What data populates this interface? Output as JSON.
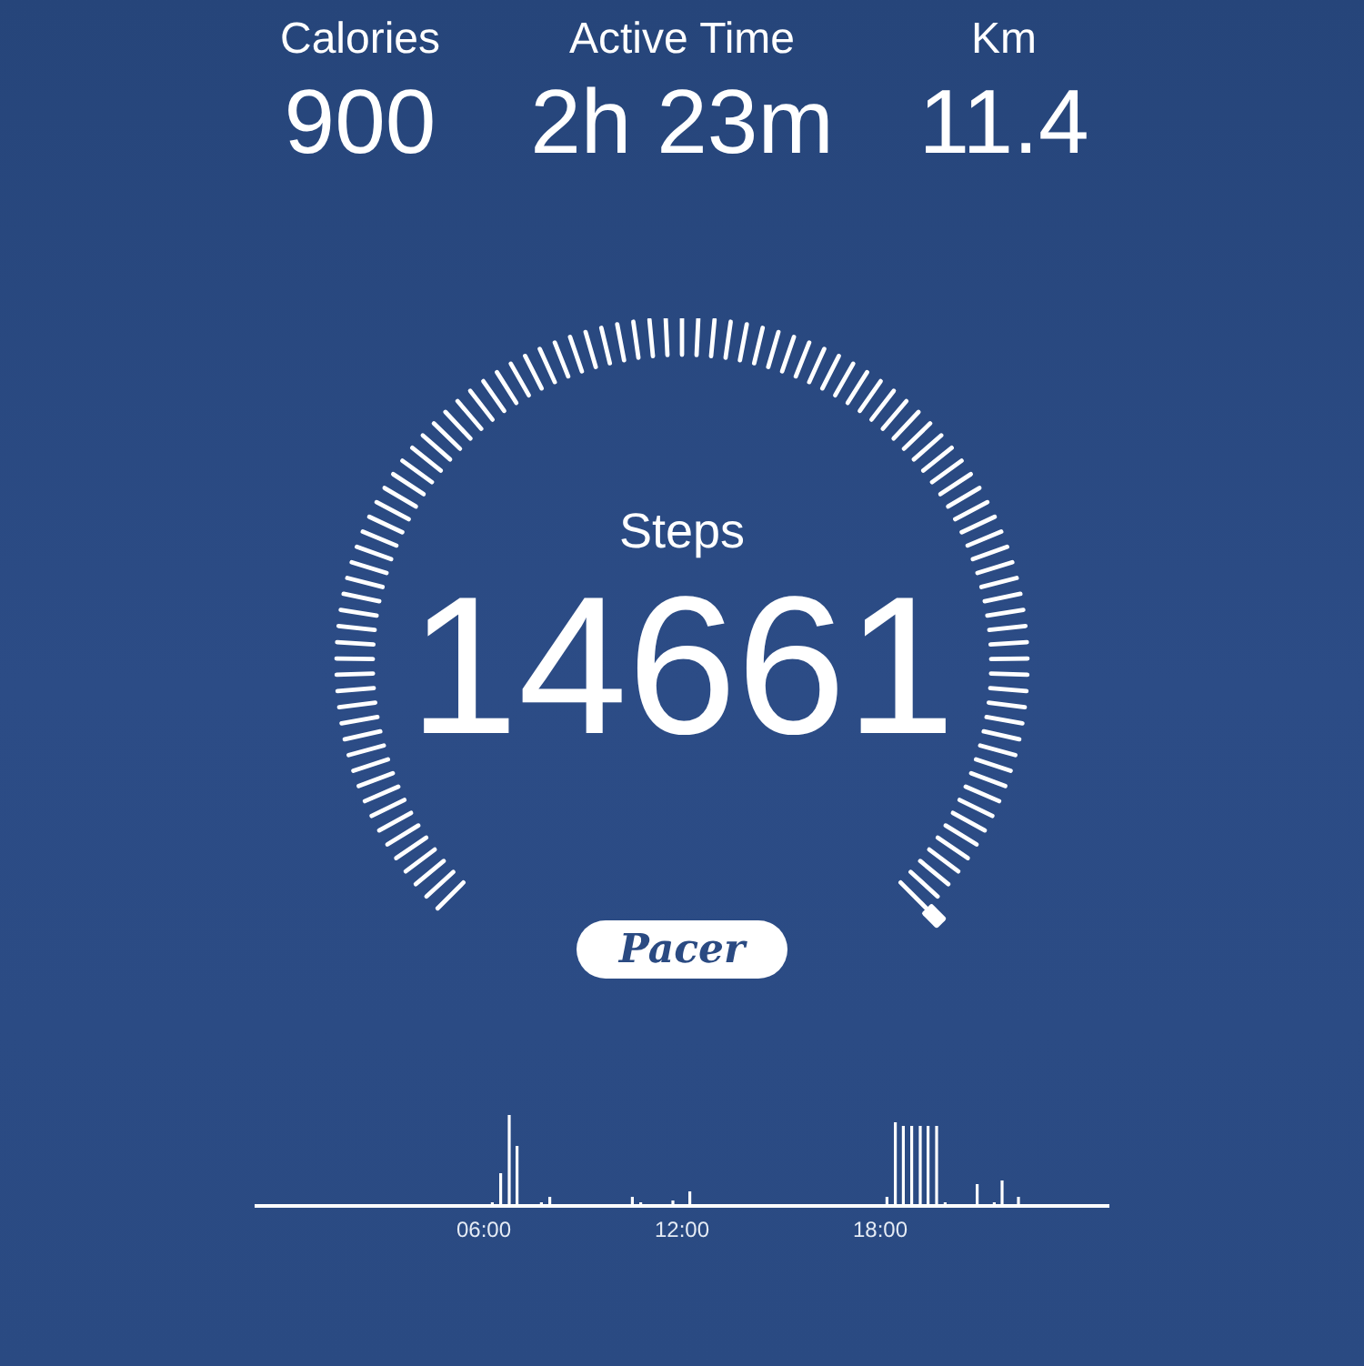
{
  "stats": [
    {
      "label": "Calories",
      "value": "900"
    },
    {
      "label": "Active Time",
      "value": "2h 23m"
    },
    {
      "label": "Km",
      "value": "11.4"
    }
  ],
  "gauge": {
    "label": "Steps",
    "value": "14661"
  },
  "badge": {
    "text": "Pacer"
  },
  "activity_chart": {
    "time_labels": [
      "06:00",
      "12:00",
      "18:00"
    ]
  }
}
